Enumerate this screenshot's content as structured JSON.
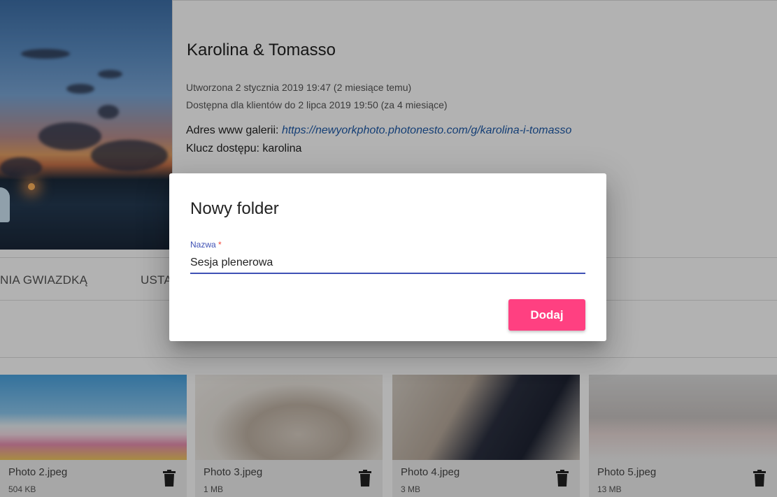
{
  "gallery": {
    "title": "Karolina & Tomasso",
    "created": "Utworzona 2 stycznia 2019 19:47 (2 miesiące temu)",
    "available": "Dostępna dla klientów do 2 lipca 2019 19:50 (za 4 miesiące)",
    "url_label": "Adres www galerii: ",
    "url": "https://newyorkphoto.photonesto.com/g/karolina-i-tomasso",
    "key_label": "Klucz dostępu: ",
    "key": "karolina"
  },
  "tabs": [
    {
      "label": "NIA GWIAZDKĄ"
    },
    {
      "label": "USTA"
    }
  ],
  "photos": [
    {
      "name": "Photo 2.jpeg",
      "size": "504 KB"
    },
    {
      "name": "Photo 3.jpeg",
      "size": "1 MB"
    },
    {
      "name": "Photo 4.jpeg",
      "size": "3 MB"
    },
    {
      "name": "Photo 5.jpeg",
      "size": "13 MB"
    }
  ],
  "dialog": {
    "title": "Nowy folder",
    "field_label": "Nazwa",
    "required_mark": " *",
    "field_value": "Sesja plenerowa",
    "submit_label": "Dodaj"
  },
  "icons": {
    "delete": "trash-icon"
  },
  "colors": {
    "accent": "#ff4081",
    "primary": "#3f51b5",
    "link": "#1e5aa8"
  }
}
